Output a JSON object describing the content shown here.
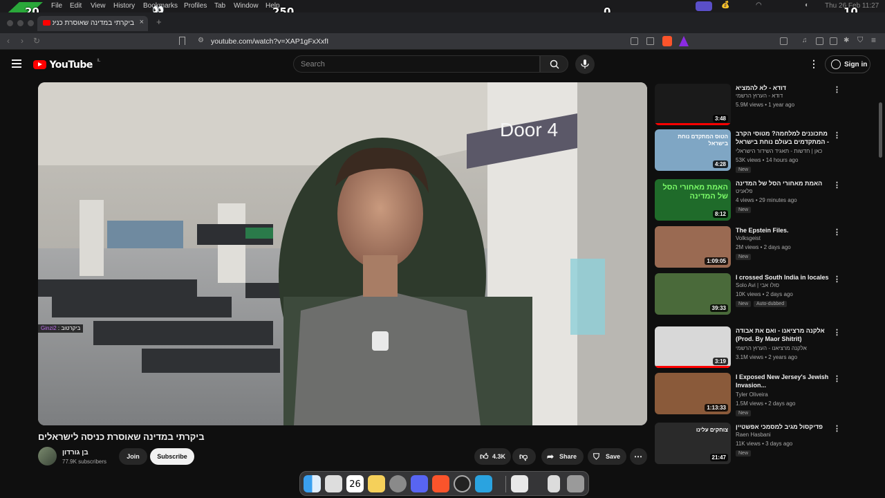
{
  "menubar": {
    "items": [
      "File",
      "Edit",
      "View",
      "History",
      "Bookmarks",
      "Profiles",
      "Tab",
      "Window",
      "Help"
    ],
    "clock": "Thu 26 Feb  11:27",
    "overlay_scores": [
      "20",
      "250",
      "0",
      "10"
    ]
  },
  "tab": {
    "title": "ביקרתי במדינה שאוסרת כניסה לישראלים",
    "close": "×",
    "new_tab": "+"
  },
  "addressbar": {
    "url": "youtube.com/watch?v=XAP1gFxXxfI"
  },
  "youtube": {
    "logo_word": "YouTube",
    "country": "IL",
    "search_placeholder": "Search",
    "sign_in": "Sign in"
  },
  "video": {
    "overlay_sign": "Door 4",
    "chat_user": "Ginzi2",
    "chat_text": " : ביקרטוב",
    "title": "ביקרתי במדינה שאוסרת כניסה לישראלים",
    "channel": "בן גורדון",
    "subscribers": "77.9K subscribers",
    "join": "Join",
    "subscribe": "Subscribe",
    "likes": "4.3K",
    "share": "Share",
    "save": "Save"
  },
  "recommendations": [
    {
      "title": "דודא - לא להמציא",
      "channel": "דודא - הערוץ הרשמי",
      "meta": "5.9M views • 1 year ago",
      "duration": "3:48",
      "badge": "",
      "extra": "",
      "bg": "#1a1a1a",
      "progress": 1.0
    },
    {
      "title": "מתכוננים למלחמה? מטוסי הקרב המתקדמים בעולם נוחת בישראל - ...",
      "channel": "כאן | חדשות - תאגיד השידור הישראלי",
      "meta": "53K views • 14 hours ago",
      "duration": "4:28",
      "badge": "New",
      "extra": "",
      "bg": "#7fa6c4",
      "progress": 0
    },
    {
      "title": "האמת מאחורי הסל של המדינה",
      "channel": "פלאניט",
      "meta": "4 views • 29 minutes ago",
      "duration": "8:12",
      "badge": "New",
      "extra": "",
      "bg": "#1f6b2a",
      "progress": 0
    },
    {
      "title": "The Epstein Files.",
      "channel": "Volksgeist",
      "meta": "2M views • 2 days ago",
      "duration": "1:09:05",
      "badge": "New",
      "extra": "",
      "bg": "#9a6a52",
      "progress": 0
    },
    {
      "title": "I crossed South India in locales",
      "channel": "Solo Avi | סולו אבי",
      "meta": "10K views • 2 days ago",
      "duration": "39:33",
      "badge": "New",
      "extra": "Auto-dubbed",
      "bg": "#4a6a3a",
      "progress": 0
    },
    {
      "title": "אלקנה מרציאנו - ואם את אבודה (Prod. By Maor Shitrit)",
      "channel": "אלקנה מרציאנו - הערוץ הרשמי",
      "meta": "3.1M views • 2 years ago",
      "duration": "3:19",
      "badge": "",
      "extra": "",
      "bg": "#d8d8d8",
      "progress": 1.0
    },
    {
      "title": "I Exposed New Jersey's Jewish Invasion...",
      "channel": "Tyler Oliveira",
      "meta": "1.5M views • 2 days ago",
      "duration": "1:13:33",
      "badge": "New",
      "extra": "",
      "bg": "#8a5a3a",
      "progress": 0
    },
    {
      "title": "פדיקסול מגיב למסמכי אפשטיין",
      "channel": "Raen Hasbani",
      "meta": "11K views • 3 days ago",
      "duration": "21:47",
      "badge": "New",
      "extra": "",
      "bg": "#2a2a2a",
      "progress": 0
    }
  ],
  "rec_thumb_text": {
    "r2": "הטוס המתקדם נוחת בישראל",
    "r3": "האמת מאחורי הסל של המדינה",
    "r8": "צוחקים עלינו"
  },
  "dock": {
    "calendar_day": "26",
    "apps": [
      "Finder",
      "Launchpad",
      "Calendar",
      "Notes",
      "System Settings",
      "Discord",
      "Brave",
      "Clock",
      "Telegram",
      "Documents",
      "Archive",
      "Trash"
    ]
  }
}
